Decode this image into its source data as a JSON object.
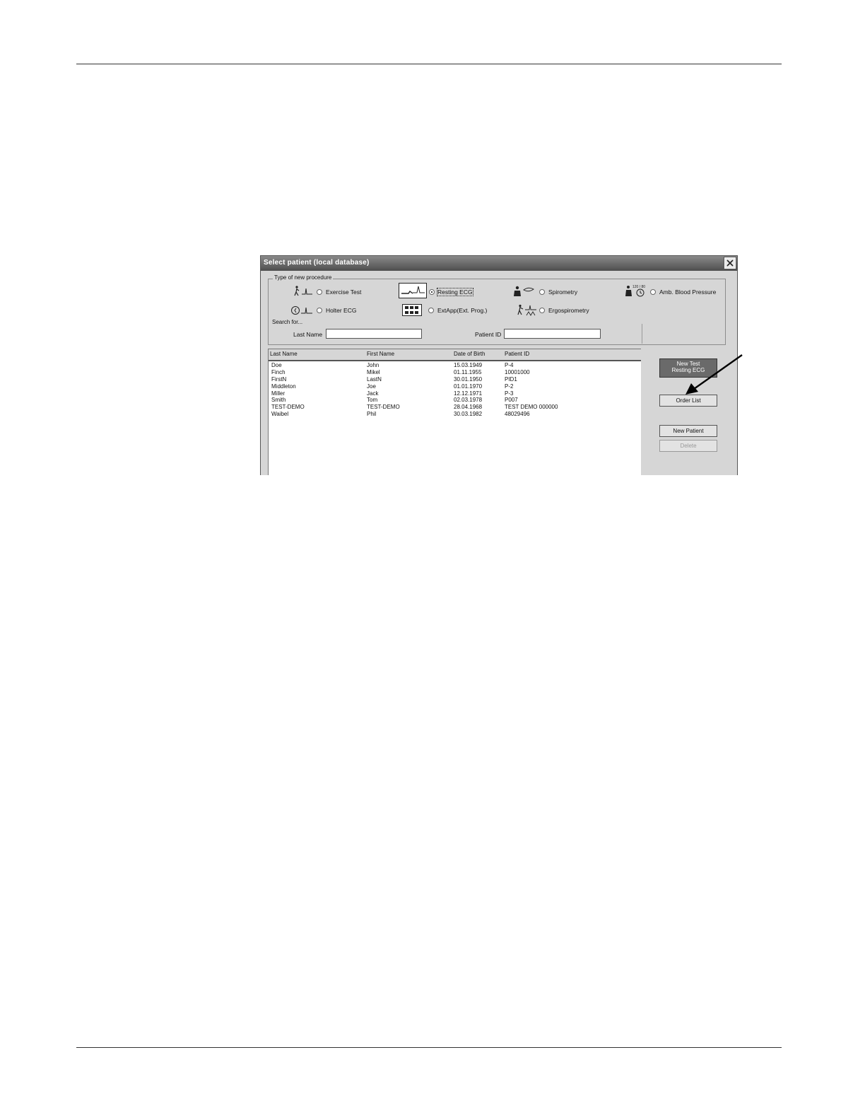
{
  "dialog": {
    "title": "Select patient (local database)",
    "close_icon": "close-icon"
  },
  "procedure": {
    "legend": "Type of new procedure",
    "options": [
      {
        "label": "Exercise Test",
        "icon": "exercise-ecg-icon",
        "selected": false
      },
      {
        "label": "Resting ECG",
        "icon": "resting-ecg-icon",
        "selected": true
      },
      {
        "label": "Spirometry",
        "icon": "spirometry-icon",
        "selected": false
      },
      {
        "label": "Amb. Blood Pressure",
        "icon": "blood-pressure-icon",
        "selected": false
      },
      {
        "label": "Holter ECG",
        "icon": "holter-ecg-icon",
        "selected": false
      },
      {
        "label": "ExtApp(Ext. Prog.)",
        "icon": "external-app-icon",
        "selected": false
      },
      {
        "label": "Ergospirometry",
        "icon": "ergospirometry-icon",
        "selected": false
      }
    ],
    "bp_icon_text": "120 / 80"
  },
  "search": {
    "legend": "Search for...",
    "last_name_label": "Last Name",
    "last_name_value": "",
    "patient_id_label": "Patient ID",
    "patient_id_value": ""
  },
  "table": {
    "columns": [
      "Last Name",
      "First Name",
      "Date of Birth",
      "Patient ID"
    ],
    "rows": [
      [
        "Doe",
        "John",
        "15.03.1949",
        "P-4"
      ],
      [
        "Finch",
        "Mikel",
        "01.11.1955",
        "10001000"
      ],
      [
        "FirstN",
        "LastN",
        "30.01.1950",
        "PID1"
      ],
      [
        "Middleton",
        "Joe",
        "01.01.1970",
        "P-2"
      ],
      [
        "Miller",
        "Jack",
        "12.12.1971",
        "P-3"
      ],
      [
        "Smith",
        "Tom",
        "02.03.1978",
        "P007"
      ],
      [
        "TEST-DEMO",
        "TEST-DEMO",
        "28.04.1968",
        "TEST DEMO 000000"
      ],
      [
        "Waibel",
        "Phil",
        "30.03.1982",
        "48029496"
      ]
    ]
  },
  "buttons": {
    "new_test_line1": "New Test",
    "new_test_line2": "Resting ECG",
    "order_list": "Order List",
    "new_patient": "New Patient",
    "delete": "Delete"
  }
}
